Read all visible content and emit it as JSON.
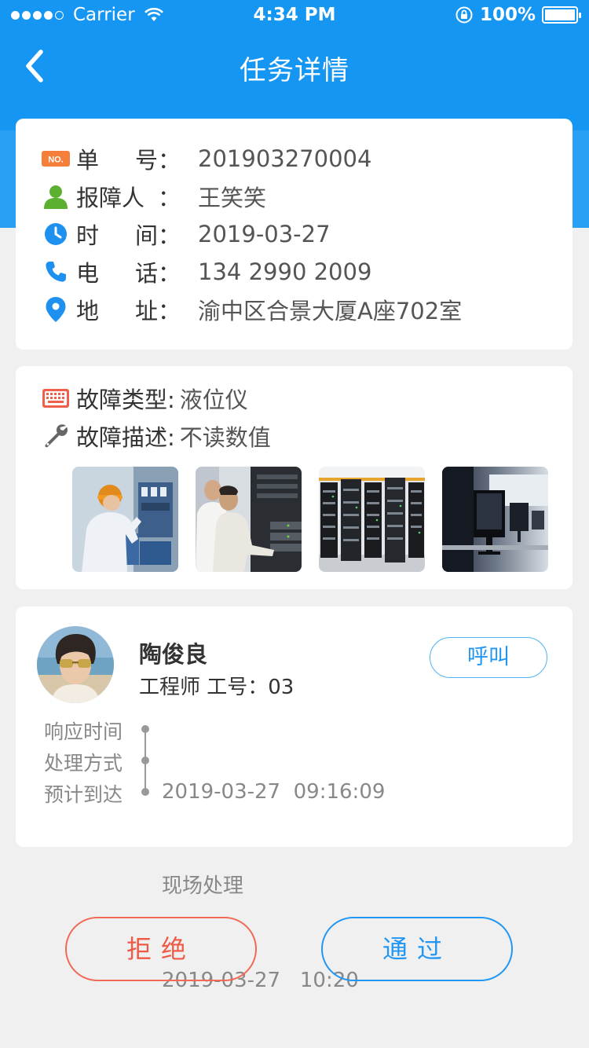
{
  "status_bar": {
    "carrier": "Carrier",
    "time": "4:34 PM",
    "battery": "100%"
  },
  "nav": {
    "title": "任务详情",
    "back_icon": "chevron-left-icon"
  },
  "colors": {
    "primary": "#1596f3",
    "reject": "#ee5a45",
    "pass": "#2196f3",
    "background": "#f0f0f0"
  },
  "ticket": {
    "number_label": [
      "单",
      "号"
    ],
    "number": "201903270004",
    "reporter_label": "报障人",
    "reporter": "王笑笑",
    "time_label": [
      "时",
      "间"
    ],
    "time": "2019-03-27",
    "phone_label": [
      "电",
      "话"
    ],
    "phone": "134 2990 2009",
    "address_label": [
      "地",
      "址"
    ],
    "address": "渝中区合景大厦A座702室",
    "colon": "："
  },
  "fault": {
    "type_label": "故障类型:",
    "type": "液位仪",
    "desc_label": "故障描述:",
    "desc": "不读数值",
    "photos": [
      "technician-at-panel",
      "engineers-at-server",
      "server-racks",
      "computer-lab"
    ]
  },
  "engineer": {
    "name": "陶俊良",
    "role": "工程师  工号：03",
    "call_label": "呼叫",
    "timeline_labels": [
      "响应时间",
      "处理方式",
      "预计到达"
    ],
    "response_time": "2019-03-27  09:16:09",
    "handling": "现场处理",
    "eta": "2019-03-27   10:20"
  },
  "actions": {
    "reject_label": "拒绝",
    "pass_label": "通过"
  }
}
